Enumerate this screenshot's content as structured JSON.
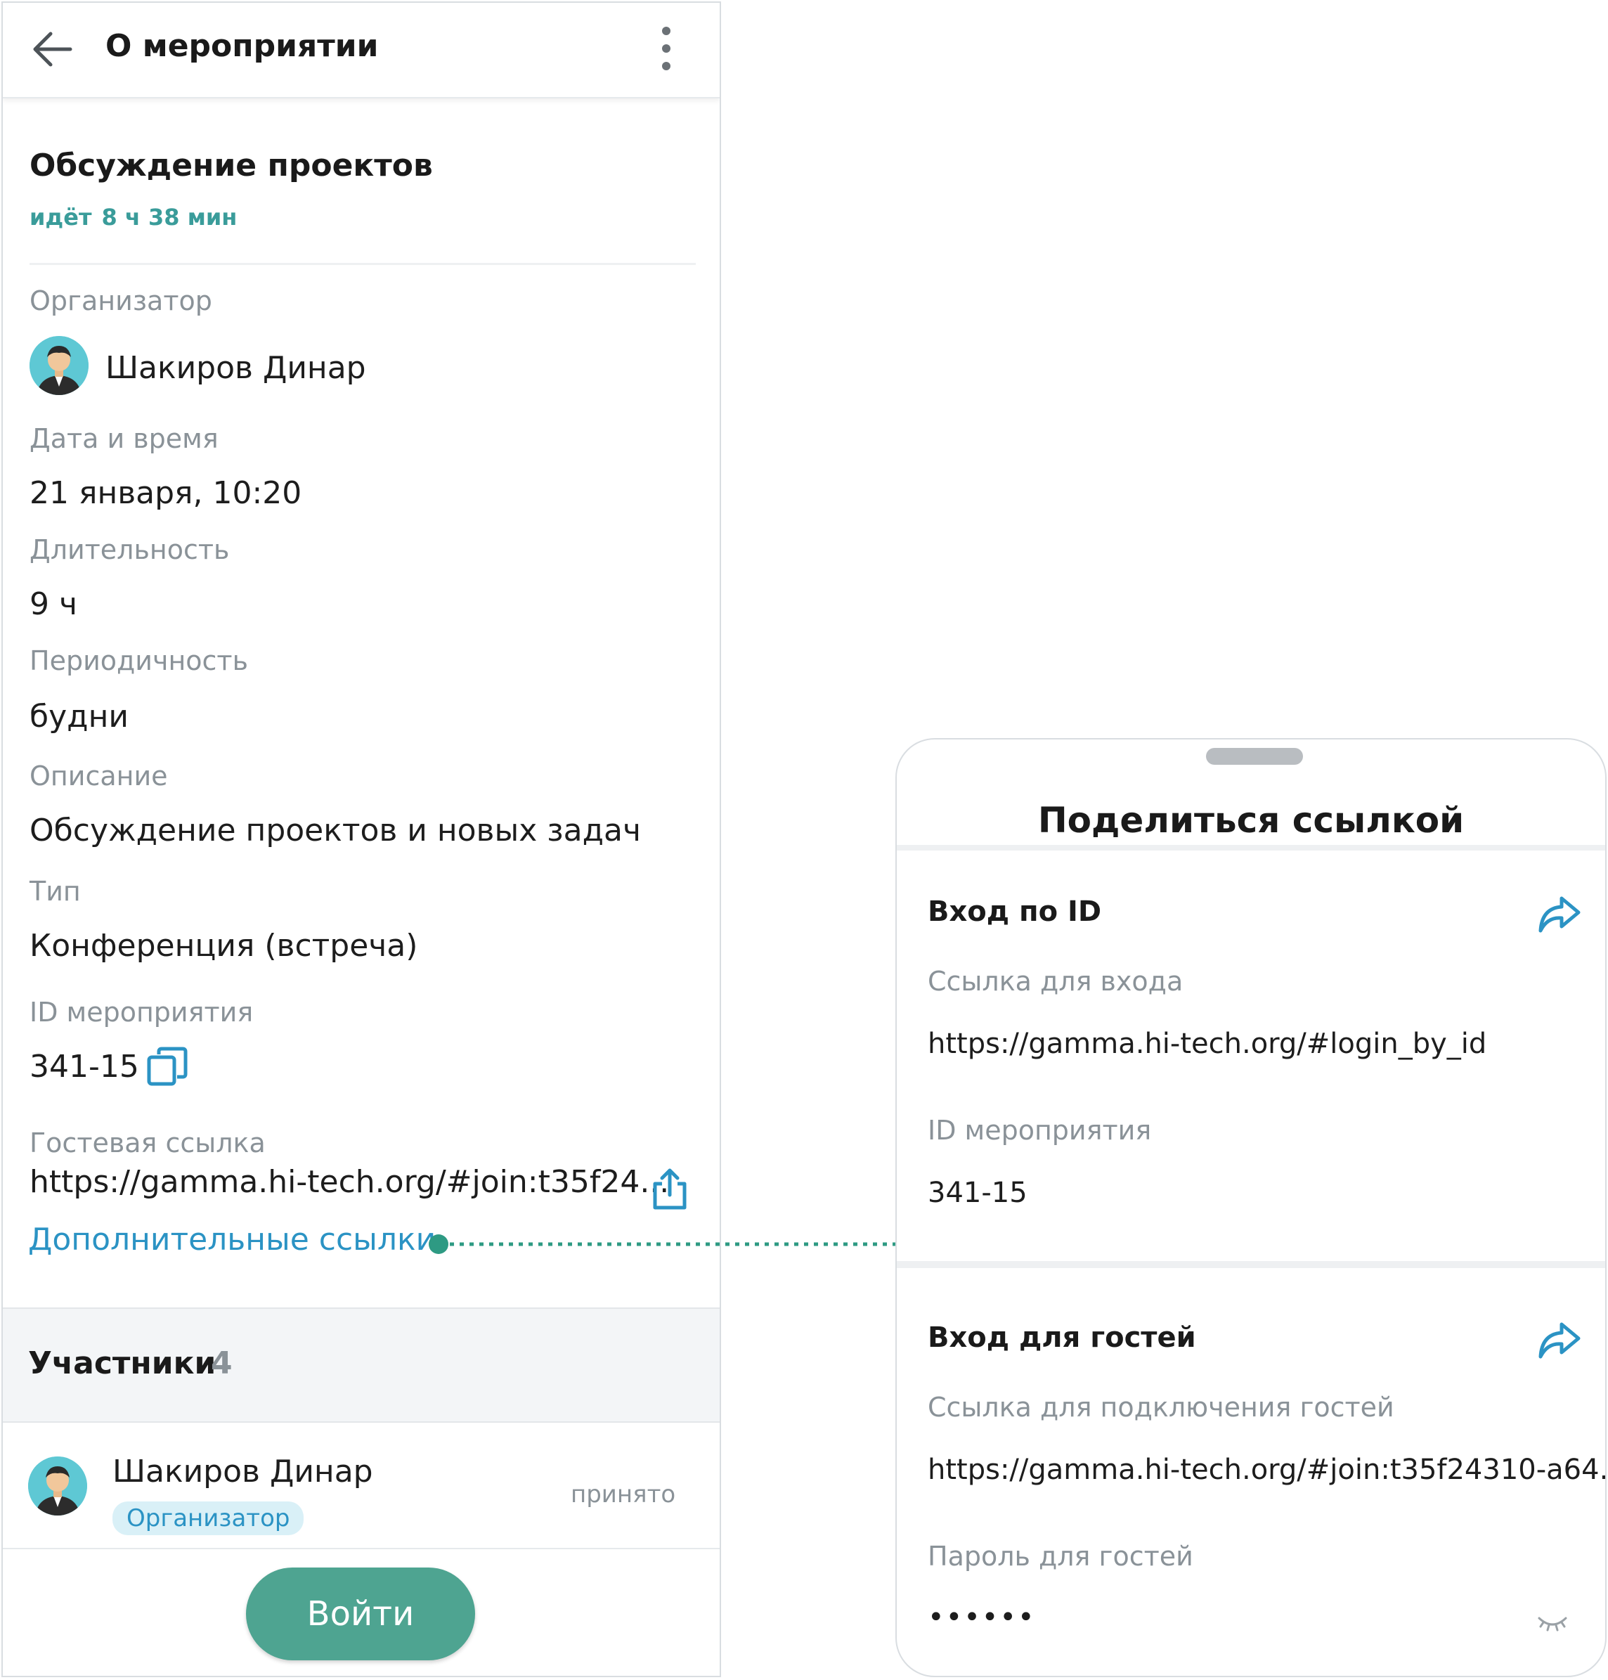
{
  "header": {
    "title": "О мероприятии"
  },
  "event": {
    "title": "Обсуждение проектов",
    "status": "идёт",
    "elapsed": "8 ч 38 мин"
  },
  "details": {
    "organizer_label": "Организатор",
    "organizer_name": "Шакиров Динар",
    "datetime_label": "Дата и время",
    "datetime_value": "21 января, 10:20",
    "duration_label": "Длительность",
    "duration_value": "9 ч",
    "recurrence_label": "Периодичность",
    "recurrence_value": "будни",
    "description_label": "Описание",
    "description_value": "Обсуждение проектов и новых задач",
    "type_label": "Тип",
    "type_value": "Конференция (встреча)",
    "id_label": "ID мероприятия",
    "id_value": "341-15",
    "guest_link_label": "Гостевая ссылка",
    "guest_link_value": "https://gamma.hi-tech.org/#join:t35f24...",
    "more_links": "Дополнительные ссылки"
  },
  "participants": {
    "title": "Участники",
    "count": "4",
    "items": [
      {
        "name": "Шакиров Динар",
        "role": "Организатор",
        "state": "принято"
      }
    ]
  },
  "join_button": "Войти",
  "share_sheet": {
    "title": "Поделиться ссылкой",
    "by_id": {
      "title": "Вход по ID",
      "link_label": "Ссылка для входа",
      "link_value": "https://gamma.hi-tech.org/#login_by_id",
      "id_label": "ID мероприятия",
      "id_value": "341-15"
    },
    "guests": {
      "title": "Вход для гостей",
      "link_label": "Ссылка для подключения гостей",
      "link_value": "https://gamma.hi-tech.org/#join:t35f24310-a64...",
      "password_label": "Пароль для гостей",
      "password_value": "••••••"
    }
  },
  "colors": {
    "accent_teal": "#3a9c9a",
    "link_blue": "#2b93c4",
    "button_green": "#4ea491",
    "muted_text": "#8a9298",
    "connector": "#2e9a83"
  },
  "icons": [
    "arrow-left-icon",
    "more-vertical-icon",
    "copy-icon",
    "share-upload-icon",
    "share-forward-icon",
    "eye-closed-icon",
    "avatar"
  ]
}
